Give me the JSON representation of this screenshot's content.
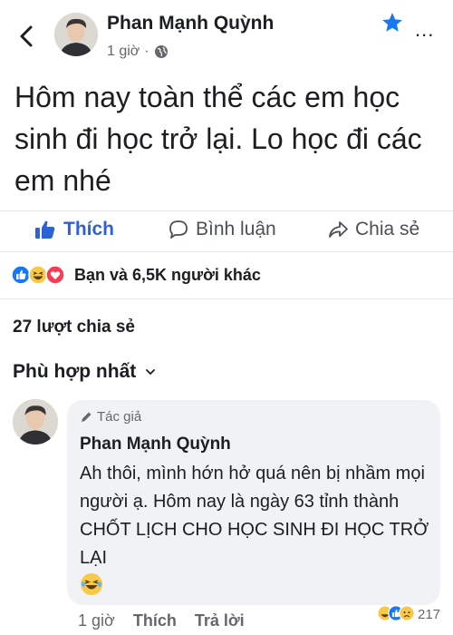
{
  "post": {
    "author": "Phan Mạnh Quỳnh",
    "time": "1 giờ",
    "separator": "·",
    "text": "Hôm nay toàn thể các em học sinh đi học trở lại. Lo học đi các em nhé",
    "icons": {
      "back": "chevron-left-icon",
      "star": "star-icon",
      "more": "more-icon",
      "privacy": "globe-icon"
    },
    "more_label": "..."
  },
  "actions": {
    "like": "Thích",
    "comment": "Bình luận",
    "share": "Chia sẻ"
  },
  "reactions": {
    "summary": "Bạn và 6,5K người khác",
    "types": [
      "like",
      "haha",
      "love"
    ]
  },
  "shares": "27 lượt chia sẻ",
  "sort": {
    "label": "Phù hợp nhất"
  },
  "comment": {
    "author_tag": "Tác giả",
    "author": "Phan Mạnh Quỳnh",
    "text": "Ah thôi, mình hớn hở quá nên bị nhầm mọi người ạ. Hôm nay là ngày 63 tỉnh thành CHỐT LỊCH CHO HỌC SINH ĐI HỌC TRỞ LẠI",
    "emoji": "laughing-tears-emoji",
    "time": "1 giờ",
    "like": "Thích",
    "reply": "Trả lời",
    "reaction_count": "217",
    "reaction_types": [
      "haha",
      "like",
      "sad"
    ]
  },
  "colors": {
    "accent": "#2d62d6",
    "star": "#1877f2",
    "bubble": "#f0f2f5",
    "muted": "#65676b"
  }
}
